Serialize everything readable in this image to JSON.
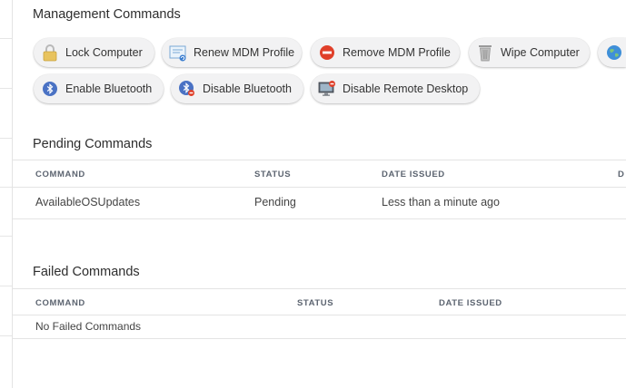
{
  "management": {
    "title": "Management Commands",
    "buttons": [
      {
        "label": "Lock Computer",
        "icon": "lock-icon"
      },
      {
        "label": "Renew MDM Profile",
        "icon": "certificate-icon"
      },
      {
        "label": "Remove MDM Profile",
        "icon": "no-entry-icon"
      },
      {
        "label": "Wipe Computer",
        "icon": "trash-icon"
      },
      {
        "label": "",
        "icon": "globe-icon"
      },
      {
        "label": "Enable Bluetooth",
        "icon": "bluetooth-icon"
      },
      {
        "label": "Disable Bluetooth",
        "icon": "bluetooth-off-icon"
      },
      {
        "label": "Disable Remote Desktop",
        "icon": "remote-desktop-off-icon"
      }
    ]
  },
  "pending": {
    "title": "Pending Commands",
    "columns": [
      "COMMAND",
      "STATUS",
      "DATE ISSUED",
      "D"
    ],
    "rows": [
      [
        "AvailableOSUpdates",
        "Pending",
        "Less than a minute ago"
      ]
    ]
  },
  "failed": {
    "title": "Failed Commands",
    "columns": [
      "COMMAND",
      "STATUS",
      "DATE ISSUED"
    ],
    "empty_text": "No Failed Commands"
  },
  "colors": {
    "button_bg": "#f2f2f3",
    "header_text": "#5c6470",
    "divider": "#e4e4e4",
    "no_entry_red": "#e0402a",
    "bluetooth_blue": "#4a72c4"
  }
}
